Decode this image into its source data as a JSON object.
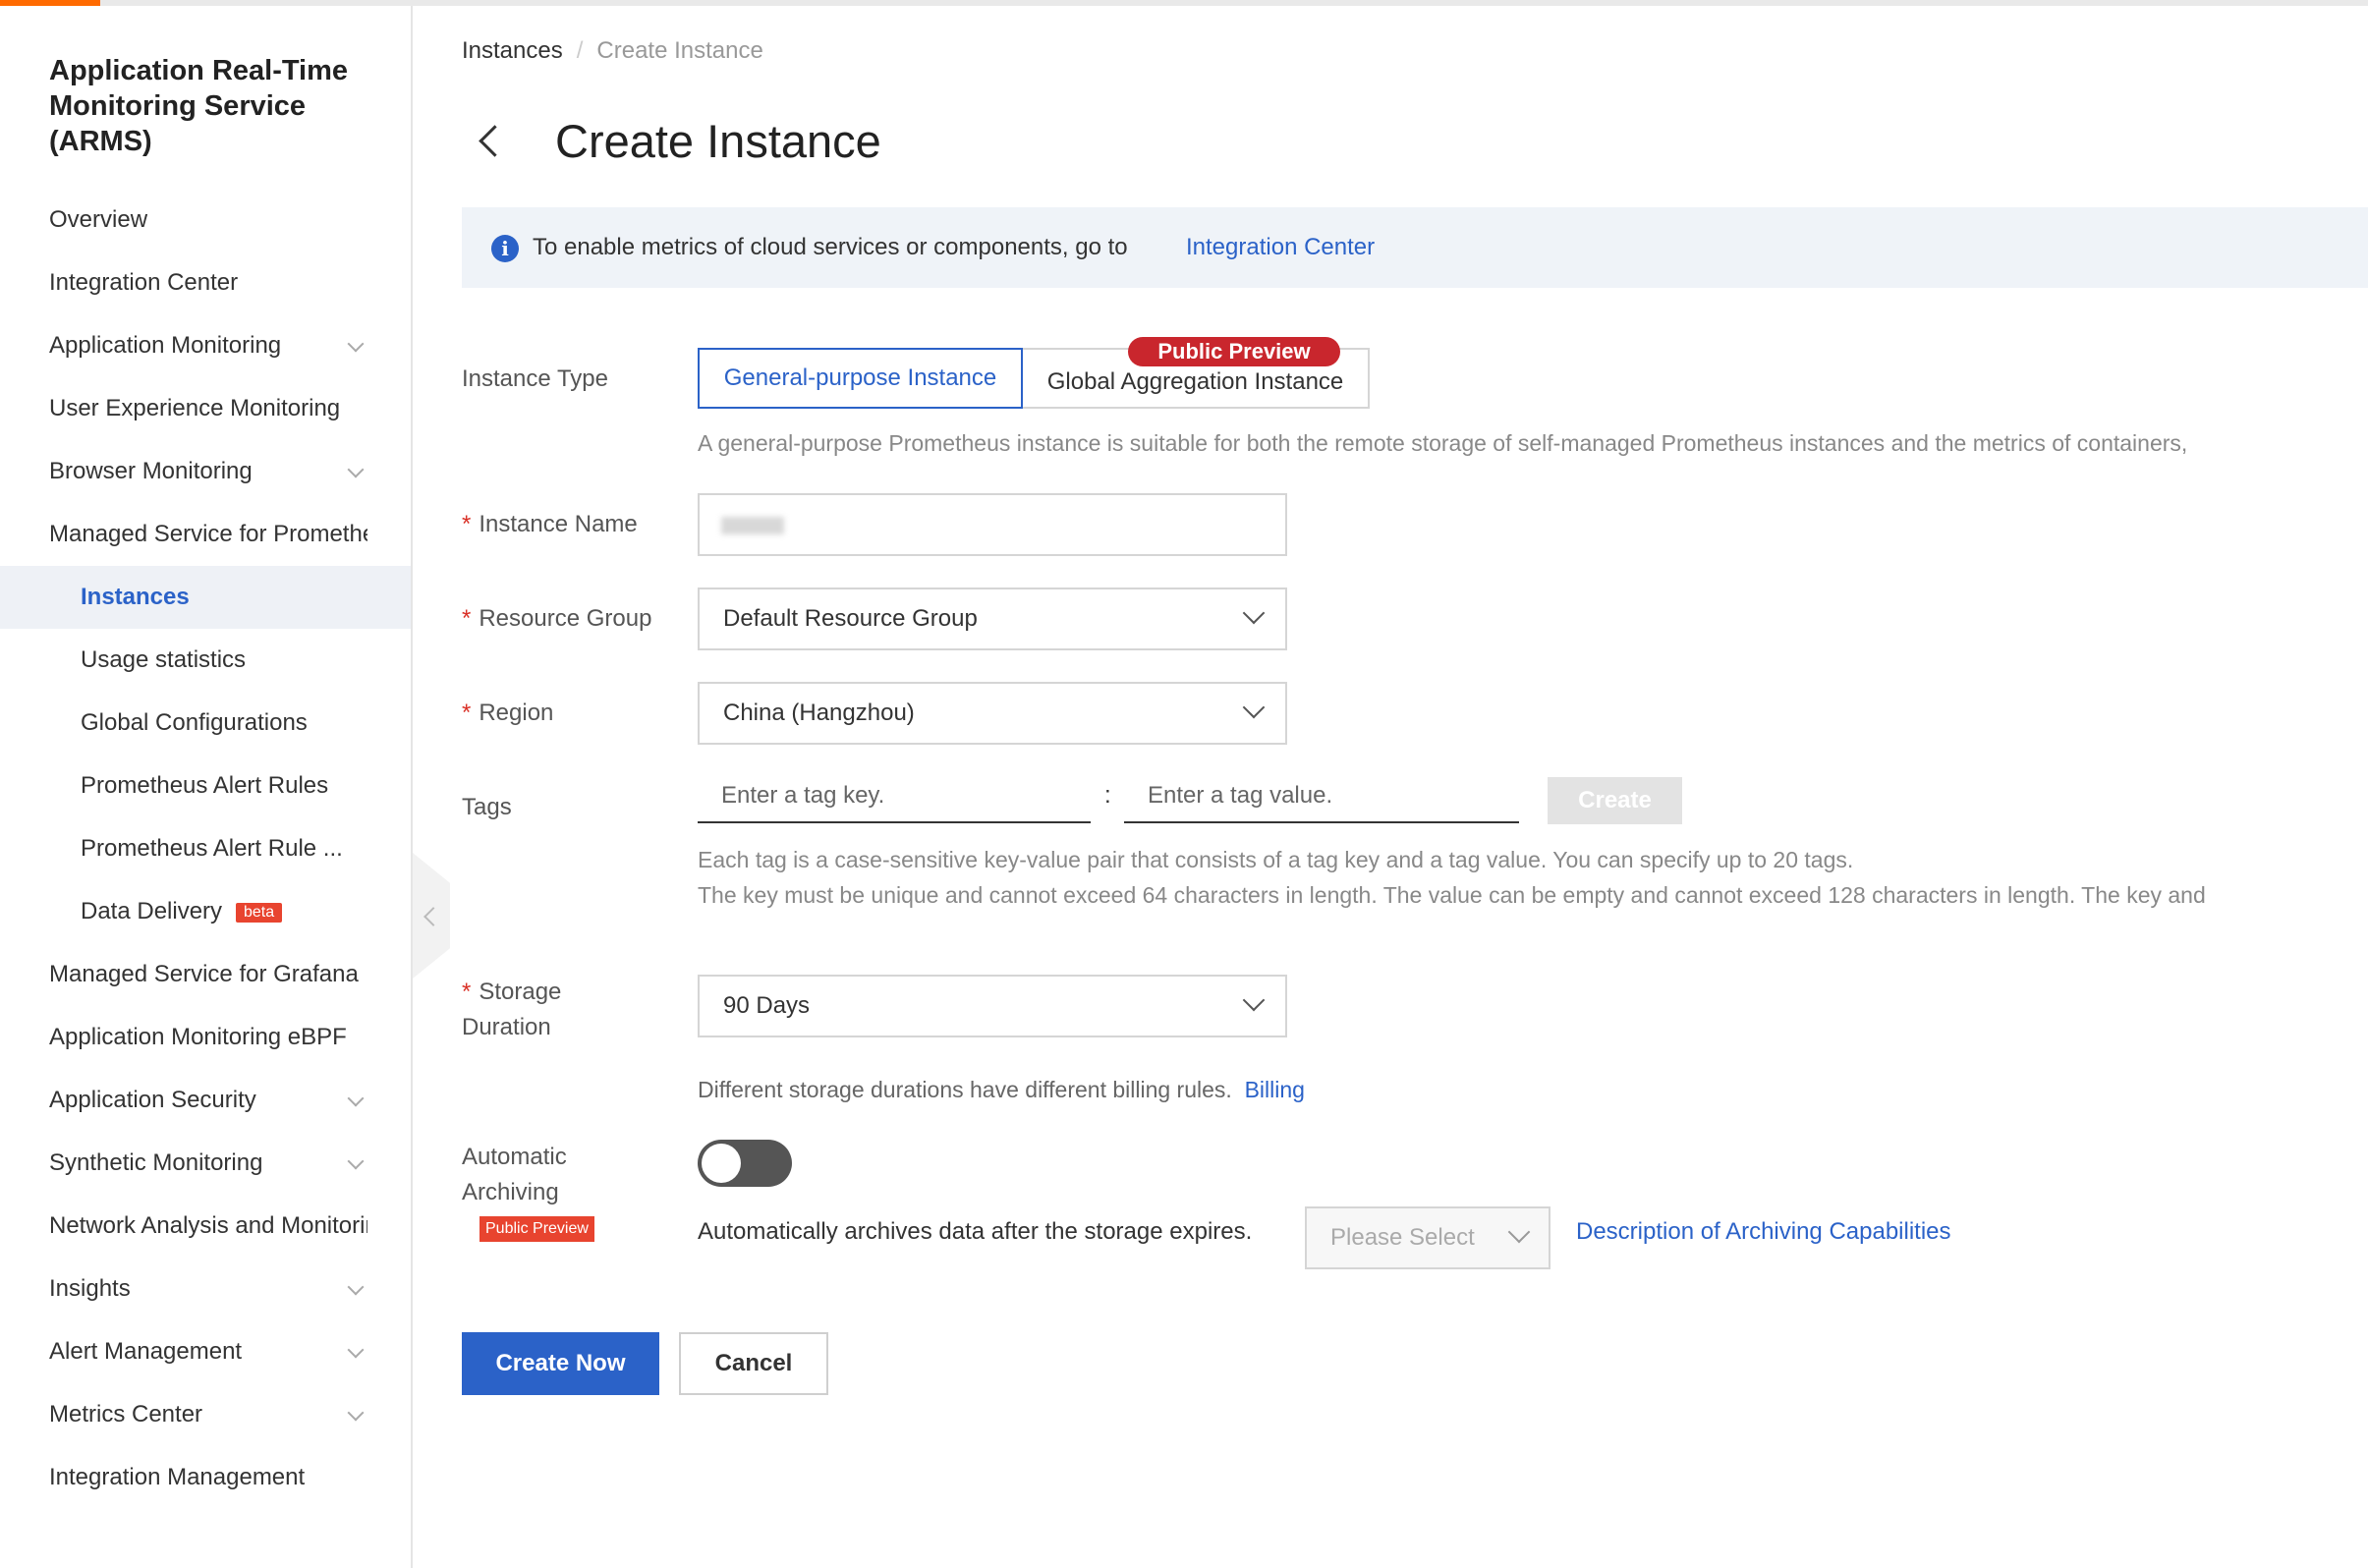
{
  "colors": {
    "accent": "#ff6a00",
    "primary": "#2b62c8",
    "required": "#d93026",
    "badge_red": "#c9262d"
  },
  "sidebar": {
    "title": "Application Real-Time Monitoring Service (ARMS)",
    "items": [
      {
        "label": "Overview"
      },
      {
        "label": "Integration Center"
      },
      {
        "label": "Application Monitoring"
      },
      {
        "label": "User Experience Monitoring"
      },
      {
        "label": "Browser Monitoring"
      },
      {
        "label": "Managed Service for Prometheus"
      },
      {
        "label": "Instances"
      },
      {
        "label": "Usage statistics"
      },
      {
        "label": "Global Configurations"
      },
      {
        "label": "Prometheus Alert Rules"
      },
      {
        "label": "Prometheus Alert Rule ..."
      },
      {
        "label": "Data Delivery",
        "badge": "beta"
      },
      {
        "label": "Managed Service for Grafana"
      },
      {
        "label": "Application Monitoring eBPF"
      },
      {
        "label": "Application Security"
      },
      {
        "label": "Synthetic Monitoring"
      },
      {
        "label": "Network Analysis and Monitoring"
      },
      {
        "label": "Insights"
      },
      {
        "label": "Alert Management"
      },
      {
        "label": "Metrics Center"
      },
      {
        "label": "Integration Management"
      }
    ]
  },
  "breadcrumb": {
    "parent": "Instances",
    "separator": "/",
    "current": "Create Instance"
  },
  "page": {
    "title": "Create Instance"
  },
  "info": {
    "text": "To enable metrics of cloud services or components, go to",
    "link": "Integration Center"
  },
  "form": {
    "instance_type": {
      "label": "Instance Type",
      "options": [
        "General-purpose Instance",
        "Global Aggregation Instance"
      ],
      "preview_badge": "Public Preview",
      "help": "A general-purpose Prometheus instance is suitable for both the remote storage of self-managed Prometheus instances and the metrics of containers,"
    },
    "instance_name": {
      "label": "Instance Name",
      "required_mark": "*"
    },
    "resource_group": {
      "label": "Resource Group",
      "required_mark": "*",
      "value": "Default Resource Group"
    },
    "region": {
      "label": "Region",
      "required_mark": "*",
      "value": "China (Hangzhou)"
    },
    "tags": {
      "label": "Tags",
      "key_placeholder": "Enter a tag key.",
      "colon": ":",
      "value_placeholder": "Enter a tag value.",
      "create_label": "Create",
      "help_line1": "Each tag is a case-sensitive key-value pair that consists of a tag key and a tag value. You can specify up to 20 tags.",
      "help_line2": "The key must be unique and cannot exceed 64 characters in length. The value can be empty and cannot exceed 128 characters in length. The key and"
    },
    "storage_duration": {
      "label_line1": "Storage",
      "label_line2": "Duration",
      "required_mark": "*",
      "value": "90 Days",
      "help": "Different storage durations have different billing rules.",
      "billing_link": "Billing"
    },
    "archiving": {
      "label_line1": "Automatic",
      "label_line2": "Archiving",
      "badge": "Public Preview",
      "enabled": false,
      "text": "Automatically archives data after the storage expires.",
      "select_placeholder": "Please Select",
      "link": "Description of Archiving Capabilities"
    }
  },
  "actions": {
    "submit": "Create Now",
    "cancel": "Cancel"
  }
}
